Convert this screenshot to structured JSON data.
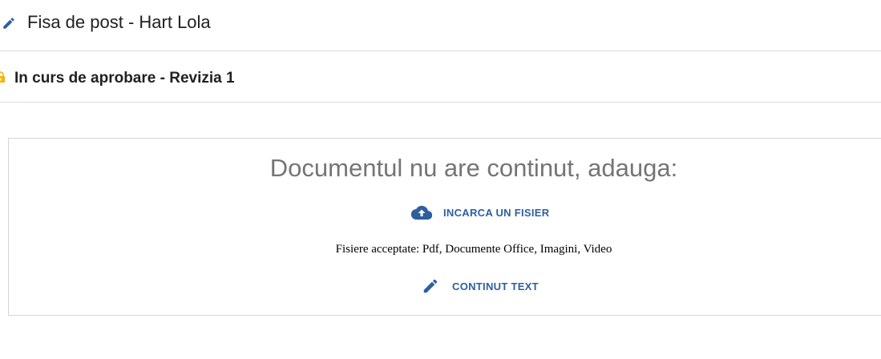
{
  "header": {
    "title": "Fisa de post - Hart Lola",
    "icon": "pencil-icon"
  },
  "status": {
    "label": "In curs de aprobare - Revizia 1",
    "icon": "lock-icon",
    "icon_color": "#f5b400"
  },
  "empty": {
    "title": "Documentul nu are continut, adauga:",
    "upload_label": "INCARCA UN FISIER",
    "upload_icon": "cloud-upload-icon",
    "accepted_text": "Fisiere acceptate: Pdf, Documente Office, Imagini, Video",
    "text_label": "CONTINUT TEXT",
    "text_icon": "pencil-icon"
  },
  "colors": {
    "accent": "#2e5f9e",
    "muted_text": "#757575"
  }
}
